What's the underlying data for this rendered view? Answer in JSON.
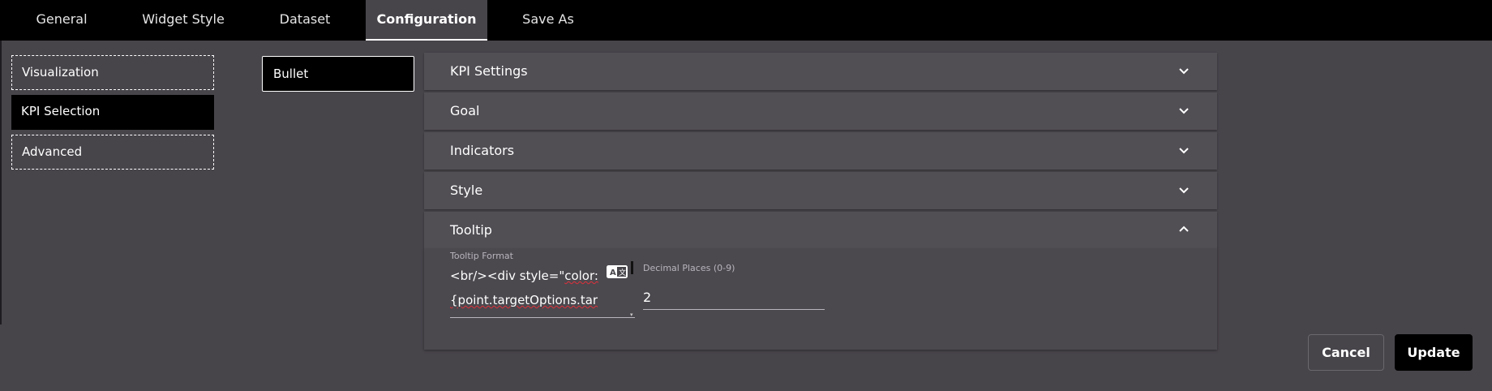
{
  "tabs": [
    {
      "label": "General"
    },
    {
      "label": "Widget Style"
    },
    {
      "label": "Dataset"
    },
    {
      "label": "Configuration"
    },
    {
      "label": "Save As"
    }
  ],
  "sidebar": {
    "items": [
      {
        "label": "Visualization"
      },
      {
        "label": "KPI Selection"
      },
      {
        "label": "Advanced"
      }
    ]
  },
  "type_selector": {
    "label": "Bullet"
  },
  "accordion": {
    "sections": [
      {
        "label": "KPI Settings"
      },
      {
        "label": "Goal"
      },
      {
        "label": "Indicators"
      },
      {
        "label": "Style"
      },
      {
        "label": "Tooltip"
      }
    ]
  },
  "tooltip": {
    "format_label": "Tooltip Format",
    "format_line1_prefix": "<br/><div style=\"",
    "format_line1_word": "color:",
    "format_line2": "{point.targetOptions.tar",
    "decimal_label": "Decimal Places (0-9)",
    "decimal_value": "2"
  },
  "footer": {
    "cancel_label": "Cancel",
    "update_label": "Update"
  }
}
